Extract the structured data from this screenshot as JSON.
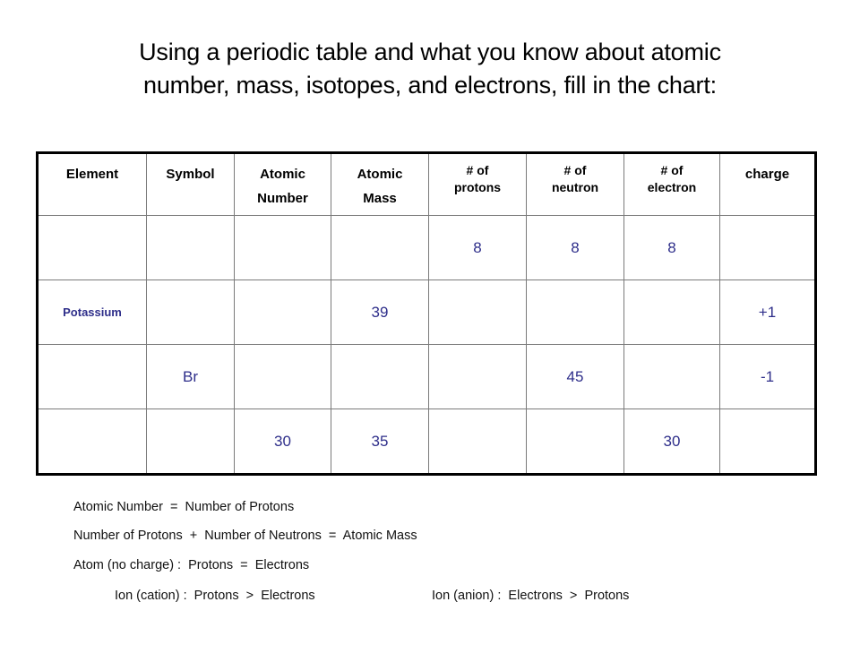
{
  "title": {
    "line1": "Using a periodic table and what you know about atomic",
    "line2": "number, mass, isotopes, and electrons, fill in the chart:"
  },
  "table": {
    "headers": [
      {
        "line1": "Element",
        "line2": ""
      },
      {
        "line1": "Symbol",
        "line2": ""
      },
      {
        "line1": "Atomic",
        "line2": "Number"
      },
      {
        "line1": "Atomic",
        "line2": "Mass"
      },
      {
        "line1": "# of",
        "line2": "protons"
      },
      {
        "line1": "# of",
        "line2": "neutron"
      },
      {
        "line1": "# of",
        "line2": "electron"
      },
      {
        "line1": "charge",
        "line2": ""
      }
    ],
    "rows": [
      [
        "",
        "",
        "",
        "",
        "8",
        "8",
        "8",
        ""
      ],
      [
        "Potassium",
        "",
        "",
        "39",
        "",
        "",
        "",
        "+1"
      ],
      [
        "",
        "Br",
        "",
        "",
        "",
        "45",
        "",
        "-1"
      ],
      [
        "",
        "",
        "30",
        "35",
        "",
        "",
        "30",
        ""
      ]
    ],
    "value_color": "#2e2e8a"
  },
  "notes": {
    "line1": "Atomic Number  =  Number of Protons",
    "line2": "Number of Protons  +  Number of Neutrons  =  Atomic Mass",
    "line3": "Atom (no charge) :  Protons  =  Electrons",
    "line4a": "Ion (cation) :  Protons  >  Electrons",
    "line4b": "Ion (anion) :  Electrons  >  Protons"
  }
}
